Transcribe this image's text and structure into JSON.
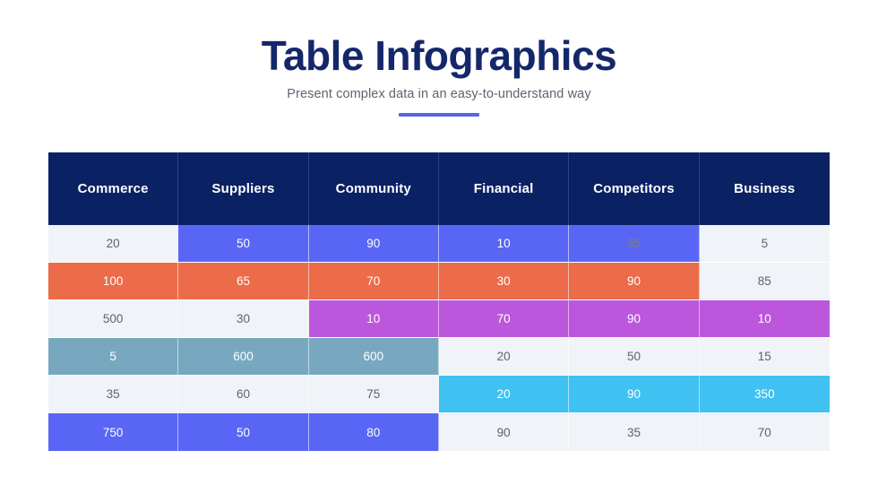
{
  "header": {
    "title": "Table Infographics",
    "subtitle": "Present complex data in an easy-to-understand way",
    "accent_color": "#5566e8"
  },
  "palette": {
    "header_bg": "#0a2164",
    "title_color": "#15276b",
    "default_cell_bg": "#f0f3f7",
    "default_cell_text": "#5a6472",
    "blue": "#5966f5",
    "orange": "#ec6b49",
    "purple": "#bc56dc",
    "steel": "#77a8bf",
    "cyan": "#3fc1f2"
  },
  "chart_data": {
    "type": "table",
    "title": "Table Infographics",
    "subtitle": "Present complex data in an easy-to-understand way",
    "columns": [
      "Commerce",
      "Suppliers",
      "Community",
      "Financial",
      "Competitors",
      "Business"
    ],
    "rows": [
      {
        "cells": [
          {
            "value": "20",
            "style": "default"
          },
          {
            "value": "50",
            "style": "blue"
          },
          {
            "value": "90",
            "style": "blue"
          },
          {
            "value": "10",
            "style": "blue"
          },
          {
            "value": "35",
            "style": "blue-muted"
          },
          {
            "value": "5",
            "style": "default"
          }
        ]
      },
      {
        "cells": [
          {
            "value": "100",
            "style": "orange"
          },
          {
            "value": "65",
            "style": "orange"
          },
          {
            "value": "70",
            "style": "orange"
          },
          {
            "value": "30",
            "style": "orange"
          },
          {
            "value": "90",
            "style": "orange"
          },
          {
            "value": "85",
            "style": "default"
          }
        ]
      },
      {
        "cells": [
          {
            "value": "500",
            "style": "default"
          },
          {
            "value": "30",
            "style": "default"
          },
          {
            "value": "10",
            "style": "purple"
          },
          {
            "value": "70",
            "style": "purple"
          },
          {
            "value": "90",
            "style": "purple"
          },
          {
            "value": "10",
            "style": "purple"
          }
        ]
      },
      {
        "cells": [
          {
            "value": "5",
            "style": "steel"
          },
          {
            "value": "600",
            "style": "steel"
          },
          {
            "value": "600",
            "style": "steel"
          },
          {
            "value": "20",
            "style": "default"
          },
          {
            "value": "50",
            "style": "default"
          },
          {
            "value": "15",
            "style": "default"
          }
        ]
      },
      {
        "cells": [
          {
            "value": "35",
            "style": "default"
          },
          {
            "value": "60",
            "style": "default"
          },
          {
            "value": "75",
            "style": "default"
          },
          {
            "value": "20",
            "style": "cyan"
          },
          {
            "value": "90",
            "style": "cyan"
          },
          {
            "value": "350",
            "style": "cyan"
          }
        ]
      },
      {
        "cells": [
          {
            "value": "750",
            "style": "blue"
          },
          {
            "value": "50",
            "style": "blue"
          },
          {
            "value": "80",
            "style": "blue"
          },
          {
            "value": "90",
            "style": "default"
          },
          {
            "value": "35",
            "style": "default"
          },
          {
            "value": "70",
            "style": "default"
          }
        ]
      }
    ]
  }
}
